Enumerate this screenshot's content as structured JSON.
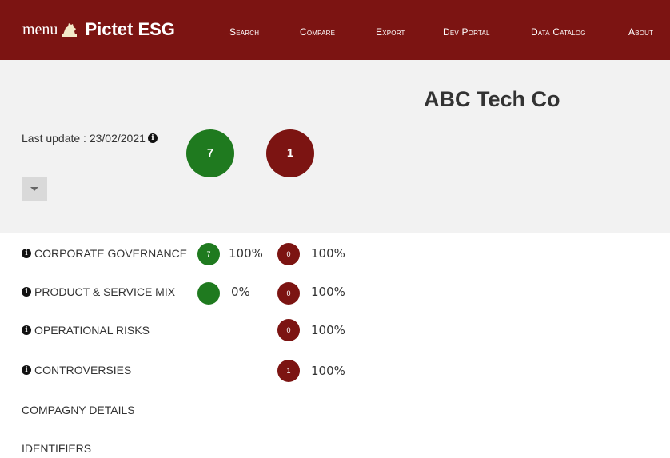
{
  "header": {
    "menu_label": "menu",
    "brand_name": "Pictet ESG",
    "nav": [
      "Search",
      "Compare",
      "Export",
      "Dev Portal",
      "Data Catalog",
      "About"
    ]
  },
  "company": {
    "name": "ABC Tech Co",
    "last_update": "Last update : 23/02/2021",
    "positive_count": "7",
    "negative_count": "1"
  },
  "sections": [
    {
      "label": "CORPORATE GOVERNANCE",
      "green_value": "7",
      "green_pct": "100%",
      "red_value": "0",
      "red_pct": "100%"
    },
    {
      "label": "PRODUCT & SERVICE MIX",
      "green_value": "",
      "green_pct": "0%",
      "red_value": "0",
      "red_pct": "100%"
    },
    {
      "label": "OPERATIONAL RISKS",
      "red_value": "0",
      "red_pct": "100%"
    },
    {
      "label": "CONTROVERSIES",
      "red_value": "1",
      "red_pct": "100%"
    }
  ],
  "links": [
    "COMPAGNY DETAILS",
    "IDENTIFIERS"
  ],
  "colors": {
    "brand": "#7c1412",
    "positive": "#1f7a1f",
    "panel": "#f2f2f2"
  },
  "icons": {
    "info": "info-icon",
    "logo": "lion-logo-icon",
    "dropdown": "caret-down-icon"
  }
}
